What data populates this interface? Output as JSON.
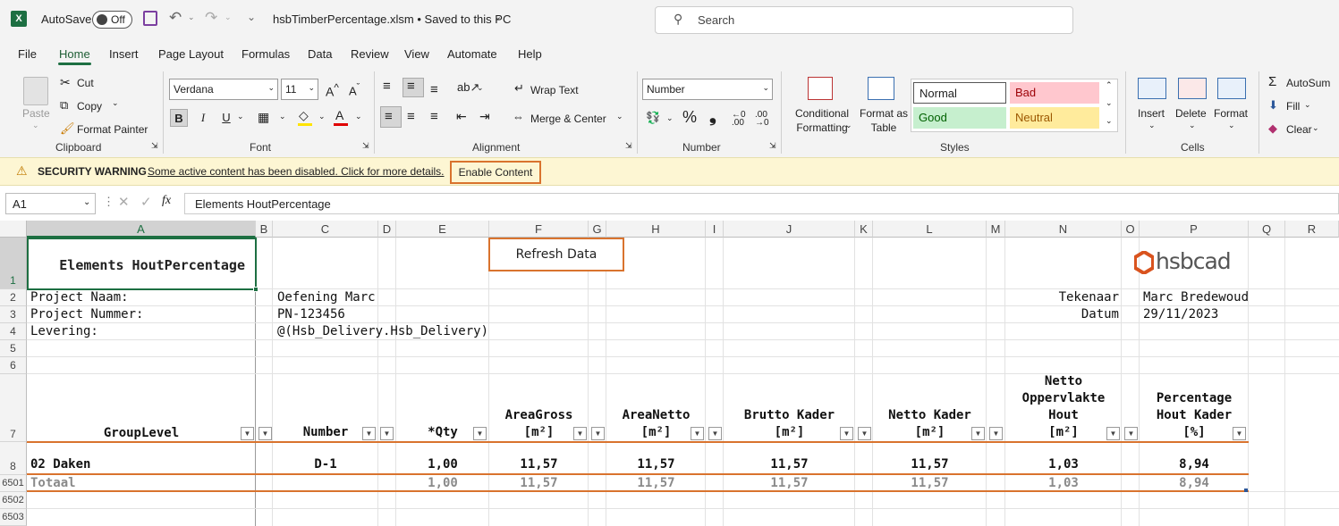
{
  "titlebar": {
    "autosave_label": "AutoSave",
    "autosave_state": "Off",
    "filename": "hsbTimberPercentage.xlsm • Saved to this PC",
    "search_placeholder": "Search",
    "app_icon_letter": "X"
  },
  "menu": [
    "File",
    "Home",
    "Insert",
    "Page Layout",
    "Formulas",
    "Data",
    "Review",
    "View",
    "Automate",
    "Help"
  ],
  "ribbon": {
    "clipboard": {
      "paste": "Paste",
      "cut": "Cut",
      "copy": "Copy",
      "format_painter": "Format Painter",
      "label": "Clipboard"
    },
    "font": {
      "family": "Verdana",
      "size": "11",
      "label": "Font",
      "bold": "B",
      "italic": "I",
      "underline": "U"
    },
    "alignment": {
      "wrap_text": "Wrap Text",
      "merge_center": "Merge & Center",
      "label": "Alignment"
    },
    "number": {
      "format": "Number",
      "percent": "%",
      "comma": "❟",
      "label": "Number"
    },
    "styles": {
      "conditional": "Conditional Formatting",
      "format_table": "Format as Table",
      "normal": "Normal",
      "bad": "Bad",
      "good": "Good",
      "neutral": "Neutral",
      "label": "Styles"
    },
    "cells": {
      "insert": "Insert",
      "delete": "Delete",
      "format": "Format",
      "label": "Cells"
    },
    "editing": {
      "autosum": "AutoSum",
      "fill": "Fill",
      "clear": "Clear"
    }
  },
  "security": {
    "title": "SECURITY WARNING",
    "message": "Some active content has been disabled. Click for more details.",
    "button": "Enable Content"
  },
  "formula_bar": {
    "name_box": "A1",
    "fx": "fx",
    "content": "Elements HoutPercentage"
  },
  "columns": [
    "A",
    "B",
    "C",
    "D",
    "E",
    "F",
    "G",
    "H",
    "I",
    "J",
    "K",
    "L",
    "M",
    "N",
    "O",
    "P",
    "Q",
    "R"
  ],
  "rows": [
    "1",
    "2",
    "3",
    "4",
    "5",
    "6",
    "7",
    "8",
    "6501",
    "6502",
    "6503"
  ],
  "sheet": {
    "title": "Elements HoutPercentage",
    "refresh_button": "Refresh Data",
    "logo": "hsbcad",
    "project_name_label": "Project Naam:",
    "project_name": "Oefening Marc",
    "project_number_label": "Project Nummer:",
    "project_number": "PN-123456",
    "delivery_label": "Levering:",
    "delivery": "@(Hsb_Delivery.Hsb_Delivery)",
    "drawer_label": "Tekenaar",
    "drawer": "Marc Bredewoud",
    "date_label": "Datum",
    "date": "29/11/2023"
  },
  "table": {
    "headers": {
      "group": "GroupLevel",
      "number": "Number",
      "qty": "*Qty",
      "area_gross": [
        "AreaGross",
        "[m²]"
      ],
      "area_netto": [
        "AreaNetto",
        "[m²]"
      ],
      "brutto": [
        "Brutto Kader",
        "[m²]"
      ],
      "netto": [
        "Netto Kader",
        "[m²]"
      ],
      "netto_hout": [
        "Netto",
        "Oppervlakte",
        "Hout",
        "[m²]"
      ],
      "percentage": [
        "Percentage",
        "Hout Kader",
        "[%]"
      ]
    },
    "row": {
      "group": "02 Daken",
      "number": "D-1",
      "qty": "1,00",
      "area_gross": "11,57",
      "area_netto": "11,57",
      "brutto": "11,57",
      "netto": "11,57",
      "netto_hout": "1,03",
      "percentage": "8,94"
    },
    "total": {
      "group": "Totaal",
      "qty": "1,00",
      "area_gross": "11,57",
      "area_netto": "11,57",
      "brutto": "11,57",
      "netto": "11,57",
      "netto_hout": "1,03",
      "percentage": "8,94"
    }
  }
}
